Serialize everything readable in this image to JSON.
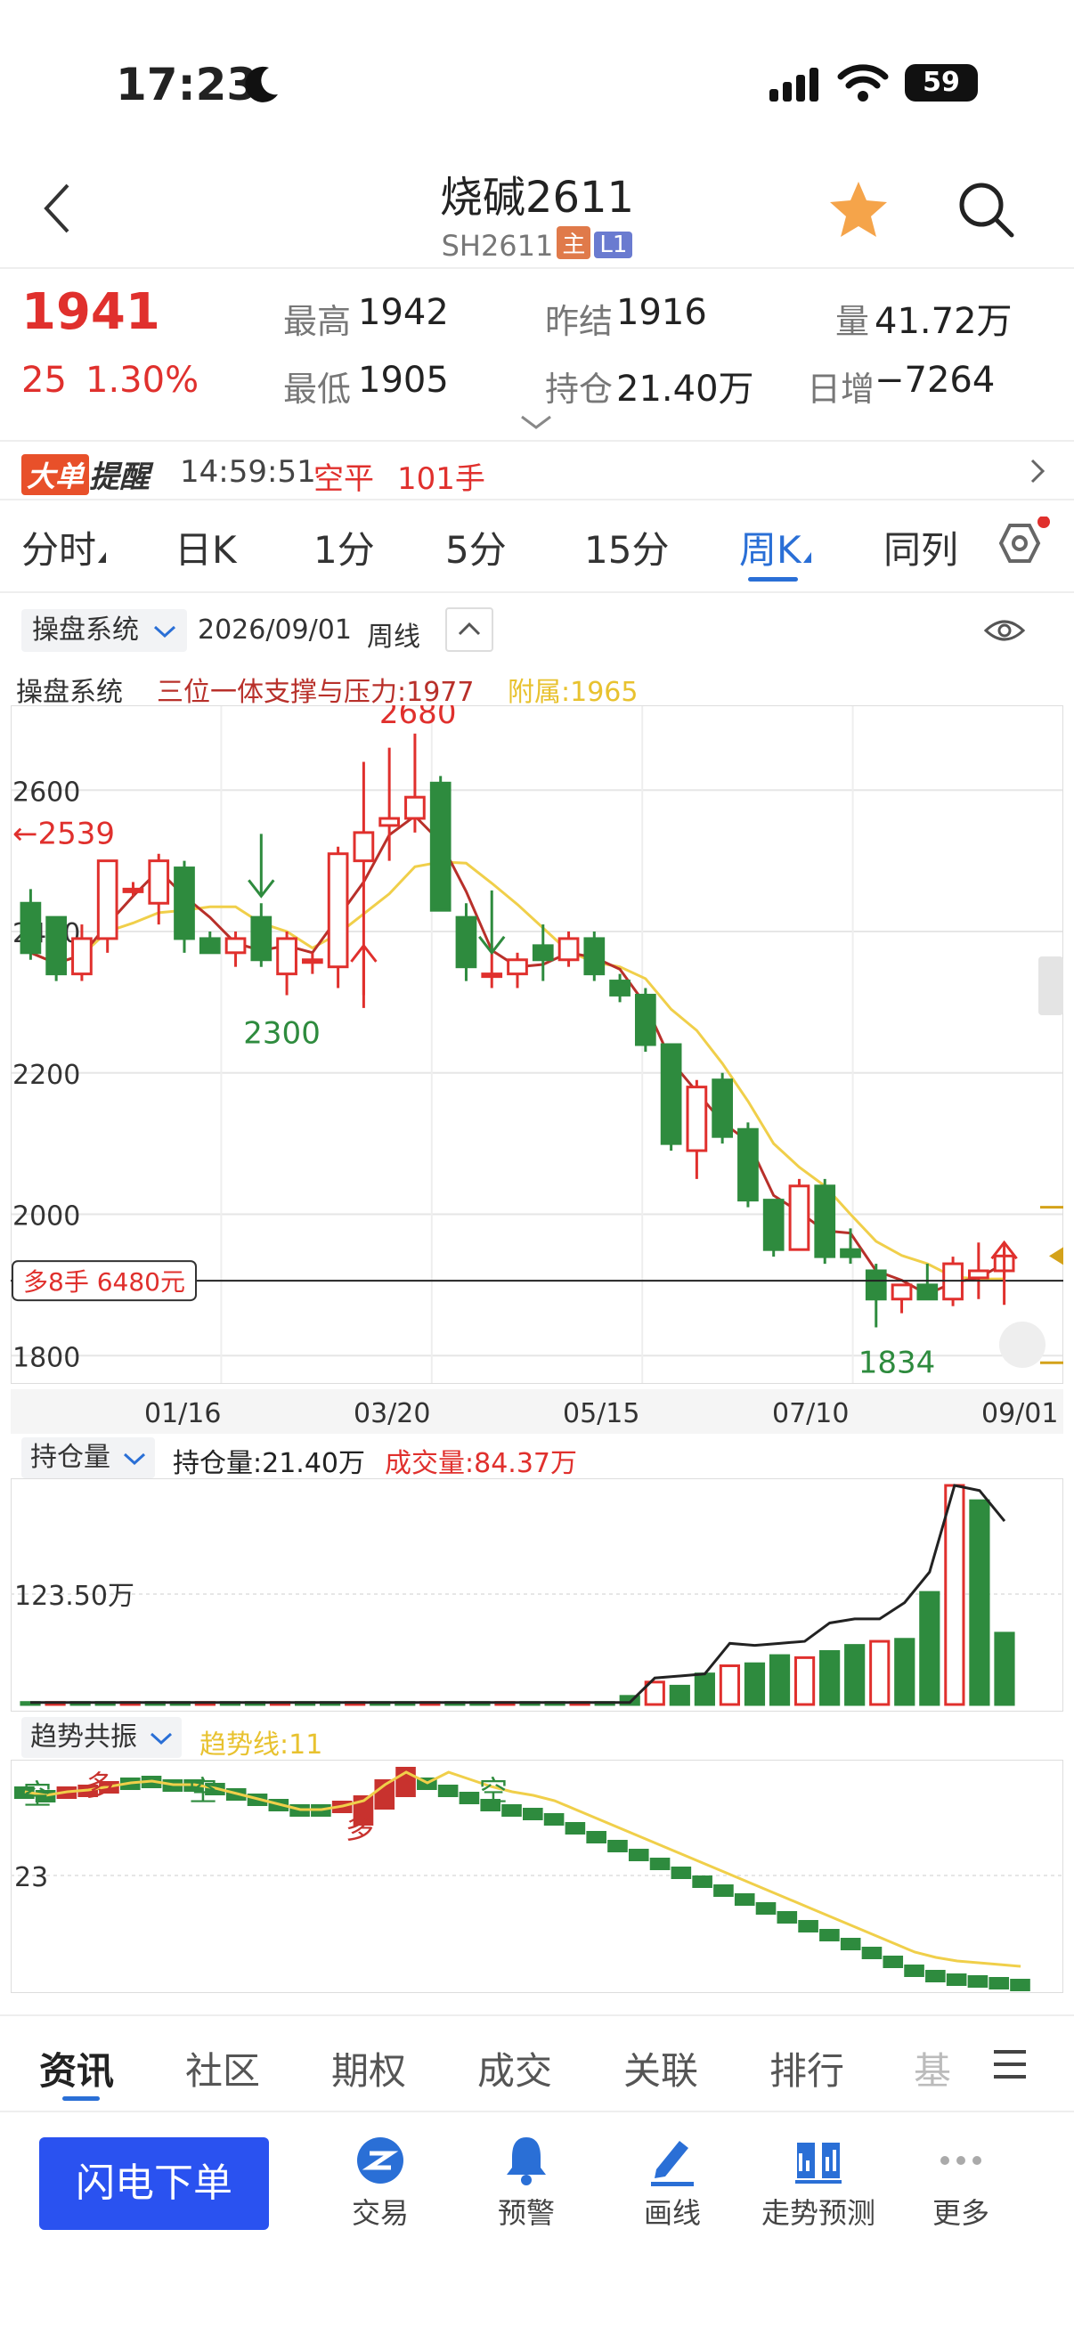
{
  "status": {
    "time": "17:23",
    "battery": "59"
  },
  "nav": {
    "title": "烧碱2611",
    "code": "SH2611",
    "tag_main": "主",
    "tag_l1": "L1"
  },
  "quote": {
    "price": "1941",
    "change": "25",
    "change_pct": "1.30%",
    "high_label": "最高",
    "high": "1942",
    "low_label": "最低",
    "low": "1905",
    "prev_label": "昨结",
    "prev": "1916",
    "oi_label": "持仓",
    "oi": "21.40万",
    "vol_label": "量",
    "vol": "41.72万",
    "daily_label": "日增",
    "daily": "−7264"
  },
  "alert": {
    "badge_a": "大单",
    "badge_b": "提醒",
    "time": "14:59:51",
    "type": "空平",
    "size": "101手"
  },
  "tabs": [
    "分时",
    "日K",
    "1分",
    "5分",
    "15分",
    "周K",
    "同列"
  ],
  "chart_header": {
    "system": "操盘系统",
    "date": "2026/09/01",
    "period": "周线"
  },
  "indicator": {
    "name": "操盘系统",
    "main": "三位一体支撑与压力:1977",
    "sub": "附属:1965"
  },
  "colors": {
    "up": "#e0302d",
    "down": "#2e8b3e",
    "ma_red": "#b8302a",
    "ma_yellow": "#f0cf4a",
    "accent": "#2a6fd6"
  },
  "chart_data": [
    {
      "type": "candlestick",
      "x_dates": [
        "01/16",
        "03/20",
        "05/15",
        "07/10",
        "09/01"
      ],
      "y_ticks": [
        2600,
        2400,
        2200,
        2000,
        1800
      ],
      "ylim": [
        1760,
        2720
      ],
      "annotations": {
        "high": "2680",
        "low_mid": "2300",
        "low_end": "1834",
        "left_arrow": "2539"
      },
      "position_label": "多8手 6480元",
      "position_price": 1906,
      "candles": [
        [
          2440,
          2460,
          2360,
          2370
        ],
        [
          2420,
          2420,
          2330,
          2340
        ],
        [
          2340,
          2410,
          2330,
          2390
        ],
        [
          2390,
          2500,
          2370,
          2500
        ],
        [
          2460,
          2470,
          2450,
          2460
        ],
        [
          2440,
          2510,
          2410,
          2500
        ],
        [
          2490,
          2500,
          2370,
          2390
        ],
        [
          2390,
          2400,
          2370,
          2370
        ],
        [
          2370,
          2400,
          2350,
          2390
        ],
        [
          2420,
          2440,
          2350,
          2360
        ],
        [
          2340,
          2400,
          2310,
          2390
        ],
        [
          2360,
          2370,
          2340,
          2360
        ],
        [
          2350,
          2520,
          2320,
          2510
        ],
        [
          2500,
          2640,
          2310,
          2540
        ],
        [
          2550,
          2660,
          2500,
          2560
        ],
        [
          2560,
          2680,
          2540,
          2590
        ],
        [
          2610,
          2620,
          2470,
          2430
        ],
        [
          2420,
          2440,
          2330,
          2350
        ],
        [
          2340,
          2380,
          2320,
          2340
        ],
        [
          2340,
          2370,
          2320,
          2360
        ],
        [
          2380,
          2410,
          2330,
          2360
        ],
        [
          2360,
          2400,
          2350,
          2390
        ],
        [
          2390,
          2400,
          2330,
          2340
        ],
        [
          2330,
          2340,
          2300,
          2310
        ],
        [
          2310,
          2320,
          2230,
          2240
        ],
        [
          2240,
          2240,
          2090,
          2100
        ],
        [
          2090,
          2190,
          2050,
          2180
        ],
        [
          2190,
          2200,
          2100,
          2110
        ],
        [
          2120,
          2130,
          2010,
          2020
        ],
        [
          2020,
          2020,
          1940,
          1950
        ],
        [
          1950,
          2050,
          1950,
          2040
        ],
        [
          2040,
          2050,
          1930,
          1940
        ],
        [
          1950,
          1980,
          1930,
          1940
        ],
        [
          1920,
          1930,
          1840,
          1880
        ],
        [
          1880,
          1900,
          1860,
          1900
        ],
        [
          1900,
          1930,
          1880,
          1880
        ],
        [
          1880,
          1940,
          1870,
          1930
        ],
        [
          1910,
          1960,
          1880,
          1920
        ],
        [
          1920,
          1950,
          1910,
          1941
        ]
      ]
    },
    {
      "type": "bar",
      "title": "持仓量",
      "oi_text": "持仓量:21.40万",
      "vol_text": "成交量:84.37万",
      "y_tick": "123.50万",
      "values": [
        2,
        2,
        2,
        2,
        2,
        2,
        2,
        2,
        2,
        2,
        2,
        2,
        2,
        2,
        2,
        2,
        2,
        2,
        2,
        2,
        2,
        2,
        2,
        2,
        8,
        22,
        18,
        30,
        38,
        40,
        48,
        46,
        52,
        58,
        62,
        64,
        110,
        215,
        200,
        70
      ],
      "line": [
        2,
        2,
        2,
        2,
        2,
        2,
        2,
        2,
        2,
        2,
        2,
        2,
        2,
        2,
        2,
        2,
        2,
        2,
        2,
        2,
        2,
        2,
        2,
        2,
        2,
        26,
        28,
        30,
        60,
        58,
        60,
        62,
        80,
        84,
        84,
        100,
        130,
        215,
        210,
        180
      ]
    },
    {
      "type": "step",
      "title": "趋势共振",
      "line_text": "趋势线:11",
      "y_tick": "23",
      "labels": [
        "空",
        "多",
        "空",
        "多",
        "空"
      ]
    }
  ],
  "bottom_tabs": [
    "资讯",
    "社区",
    "期权",
    "成交",
    "关联",
    "排行",
    "基"
  ],
  "actions": {
    "order": "闪电下单",
    "trade": "交易",
    "alert": "预警",
    "draw": "画线",
    "forecast": "走势预测",
    "more": "更多"
  }
}
